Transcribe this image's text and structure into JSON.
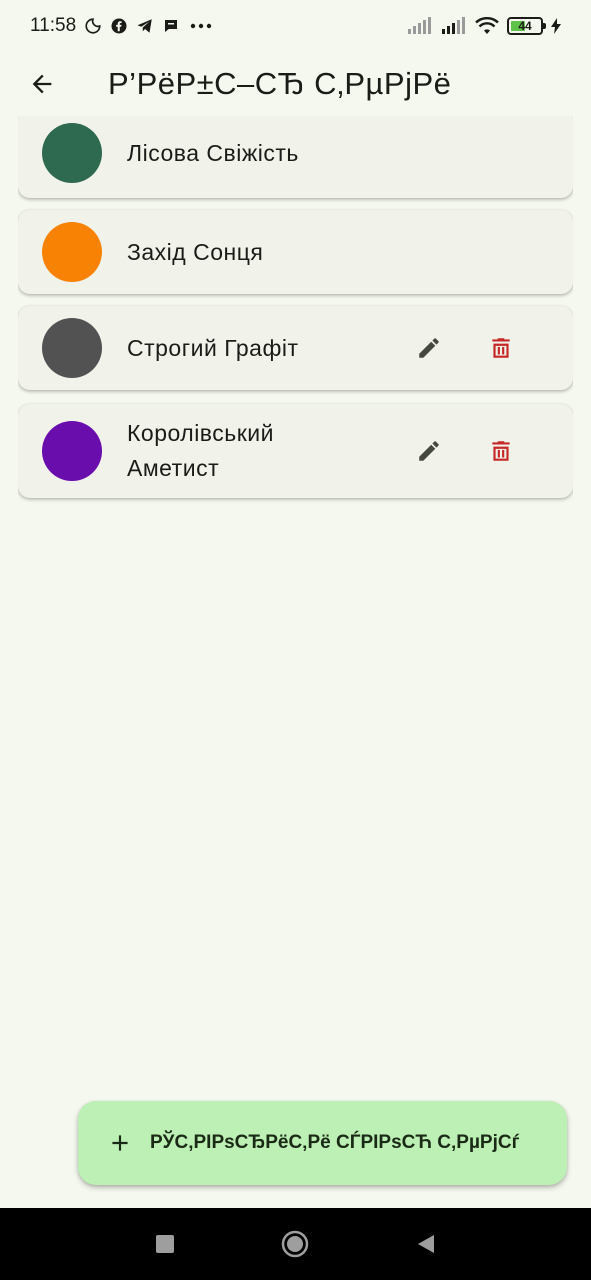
{
  "status_bar": {
    "time": "11:58",
    "battery_level": "44",
    "icons": [
      "moon-icon",
      "facebook-icon",
      "telegram-icon",
      "chat-bubble-icon",
      "more-dots-icon",
      "signal-icon",
      "signal-icon",
      "wifi-icon",
      "battery-icon",
      "charging-bolt-icon"
    ]
  },
  "app_bar": {
    "title": "Р’РёР±С–СЂ С‚РµРјРё",
    "back_icon": "arrow-back-icon"
  },
  "themes": [
    {
      "label": "Лісова Свіжість",
      "color": "#2e6a50",
      "editable": false
    },
    {
      "label": "Захід Сонця",
      "color": "#f78204",
      "editable": false
    },
    {
      "label": "Строгий Графіт",
      "color": "#525252",
      "editable": true
    },
    {
      "label": "Королівський Аметист",
      "color": "#6a0dad",
      "editable": true
    }
  ],
  "actions": {
    "edit_icon": "pencil-icon",
    "delete_icon": "trash-icon",
    "delete_color": "#c62828"
  },
  "fab": {
    "label": "РЎС‚РІРѕСЂРёС‚Рё СЃРІРѕСЋ С‚РµРјСѓ",
    "icon": "plus-icon",
    "background": "#bdf0b4"
  },
  "nav_bar": {
    "icons": [
      "recents-square-icon",
      "home-circle-icon",
      "back-triangle-icon"
    ]
  }
}
